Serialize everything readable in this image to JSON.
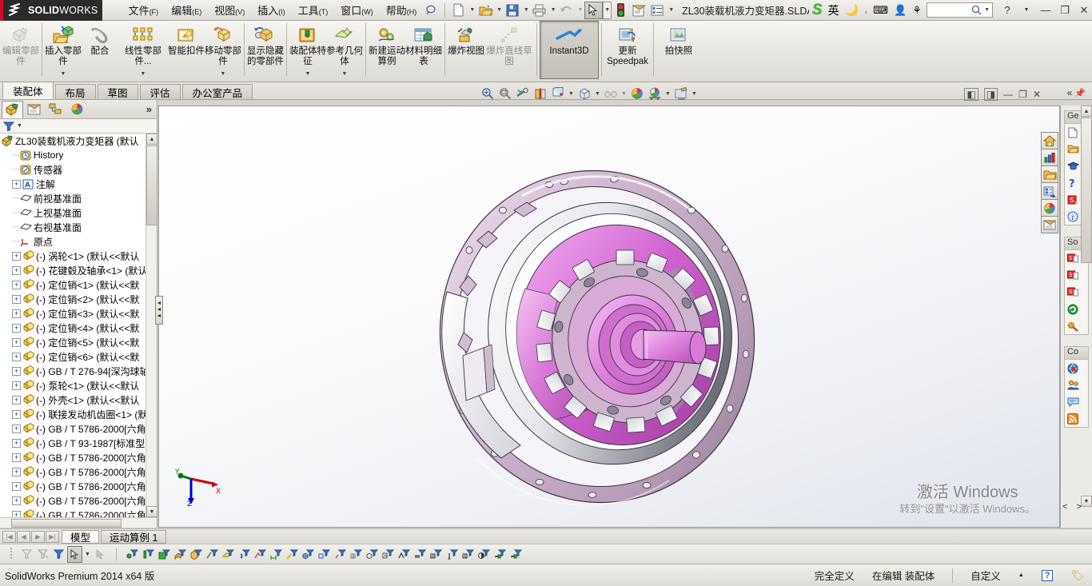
{
  "titlebar": {
    "brand_ds": "2S",
    "brand_name": "SOLID",
    "brand_name2": "WORKS",
    "menus": [
      {
        "label": "文件",
        "key": "(F)"
      },
      {
        "label": "编辑",
        "key": "(E)"
      },
      {
        "label": "视图",
        "key": "(V)"
      },
      {
        "label": "插入",
        "key": "(I)"
      },
      {
        "label": "工具",
        "key": "(T)"
      },
      {
        "label": "窗口",
        "key": "(W)"
      },
      {
        "label": "帮助",
        "key": "(H)"
      }
    ],
    "document_title": "ZL30装载机液力变矩器.SLDA",
    "ime_lang": "英",
    "search_placeholder": ""
  },
  "ribbon": {
    "buttons": [
      {
        "name": "edit-component",
        "label": "编辑零部件",
        "icon": "edit-component-icon",
        "disabled": true,
        "caret": false,
        "pressed": false
      },
      {
        "name": "insert-components",
        "label": "插入零部件",
        "icon": "insert-component-icon",
        "disabled": false,
        "caret": true,
        "pressed": false
      },
      {
        "name": "mate",
        "label": "配合",
        "icon": "mate-icon",
        "disabled": false,
        "caret": false,
        "pressed": false
      },
      {
        "name": "linear-component-pattern",
        "label": "线性零部件...",
        "icon": "linear-pattern-icon",
        "disabled": false,
        "caret": true,
        "pressed": false
      },
      {
        "name": "smart-fasteners",
        "label": "智能扣件",
        "icon": "smart-fastener-icon",
        "disabled": false,
        "caret": false,
        "pressed": false
      },
      {
        "name": "move-component",
        "label": "移动零部件",
        "icon": "move-component-icon",
        "disabled": false,
        "caret": true,
        "pressed": false
      },
      {
        "name": "show-hidden-components",
        "label": "显示隐藏的零部件",
        "icon": "show-hidden-icon",
        "disabled": false,
        "caret": false,
        "pressed": false
      },
      {
        "name": "assembly-features",
        "label": "装配体特征",
        "icon": "assembly-feature-icon",
        "disabled": false,
        "caret": true,
        "pressed": false
      },
      {
        "name": "reference-geometry",
        "label": "参考几何体",
        "icon": "reference-geometry-icon",
        "disabled": false,
        "caret": true,
        "pressed": false
      },
      {
        "name": "new-motion-study",
        "label": "新建运动算例",
        "icon": "motion-study-icon",
        "disabled": false,
        "caret": false,
        "pressed": false
      },
      {
        "name": "bill-of-materials",
        "label": "材料明细表",
        "icon": "bom-icon",
        "disabled": false,
        "caret": false,
        "pressed": false
      },
      {
        "name": "exploded-view",
        "label": "爆炸视图",
        "icon": "exploded-view-icon",
        "disabled": false,
        "caret": false,
        "pressed": false
      },
      {
        "name": "explode-line-sketch",
        "label": "爆炸直线草图",
        "icon": "explode-line-icon",
        "disabled": true,
        "caret": false,
        "pressed": false
      },
      {
        "name": "instant3d",
        "label": "Instant3D",
        "icon": "instant3d-icon",
        "disabled": false,
        "caret": false,
        "pressed": true
      },
      {
        "name": "update-speedpak",
        "label": "更新Speedpak",
        "icon": "speedpak-icon",
        "disabled": false,
        "caret": false,
        "pressed": false
      },
      {
        "name": "take-snapshot",
        "label": "拍快照",
        "icon": "snapshot-icon",
        "disabled": false,
        "caret": false,
        "pressed": false
      }
    ],
    "separators_after": [
      0,
      6,
      9,
      12,
      13
    ]
  },
  "command_tabs": [
    {
      "label": "装配体",
      "active": true
    },
    {
      "label": "布局",
      "active": false
    },
    {
      "label": "草图",
      "active": false
    },
    {
      "label": "评估",
      "active": false
    },
    {
      "label": "办公室产品",
      "active": false
    }
  ],
  "viewport_toolbar": [
    {
      "name": "zoom-to-fit-icon",
      "caret": false
    },
    {
      "name": "zoom-to-area-icon",
      "caret": false
    },
    {
      "name": "previous-view-icon",
      "caret": false
    },
    {
      "name": "section-view-icon",
      "caret": false
    },
    {
      "name": "view-orientation-icon",
      "caret": true
    },
    {
      "name": "display-style-icon",
      "caret": true
    },
    {
      "name": "hide-show-items-icon",
      "caret": true
    },
    {
      "name": "edit-appearance-icon",
      "caret": false
    },
    {
      "name": "apply-scene-icon",
      "caret": true
    },
    {
      "name": "view-settings-icon",
      "caret": true
    }
  ],
  "window_buttons": [
    "restore-left-icon",
    "restore-right-icon",
    "minimize-icon",
    "maximize-icon",
    "close-icon"
  ],
  "left_panel": {
    "tabs": [
      {
        "name": "feature-manager-tab",
        "icon": "feature-tree-icon",
        "active": true
      },
      {
        "name": "property-manager-tab",
        "icon": "property-manager-icon",
        "active": false
      },
      {
        "name": "configuration-manager-tab",
        "icon": "configuration-icon",
        "active": false
      },
      {
        "name": "display-manager-tab",
        "icon": "display-manager-icon",
        "active": false
      }
    ],
    "more_label": "»",
    "filter_icon": "filter-icon",
    "tree": [
      {
        "label": "ZL30装载机液力变矩器  (默认",
        "icon": "assembly-icon",
        "expand": "none",
        "indent": 0,
        "root": true
      },
      {
        "label": "History",
        "icon": "history-icon",
        "expand": "none",
        "indent": 1
      },
      {
        "label": "传感器",
        "icon": "sensor-icon",
        "expand": "none",
        "indent": 1
      },
      {
        "label": "注解",
        "icon": "annotation-icon",
        "expand": "plus",
        "indent": 1
      },
      {
        "label": "前视基准面",
        "icon": "plane-icon",
        "expand": "none",
        "indent": 1
      },
      {
        "label": "上视基准面",
        "icon": "plane-icon",
        "expand": "none",
        "indent": 1
      },
      {
        "label": "右视基准面",
        "icon": "plane-icon",
        "expand": "none",
        "indent": 1
      },
      {
        "label": "原点",
        "icon": "origin-icon",
        "expand": "none",
        "indent": 1
      },
      {
        "label": "(-) 涡轮<1>  (默认<<默认",
        "icon": "part-icon",
        "expand": "plus",
        "indent": 1
      },
      {
        "label": "(-) 花键毂及轴承<1>  (默认",
        "icon": "part-icon",
        "expand": "plus",
        "indent": 1
      },
      {
        "label": "(-) 定位销<1>  (默认<<默",
        "icon": "part-icon",
        "expand": "plus",
        "indent": 1
      },
      {
        "label": "(-) 定位销<2>  (默认<<默",
        "icon": "part-icon",
        "expand": "plus",
        "indent": 1
      },
      {
        "label": "(-) 定位销<3>  (默认<<默",
        "icon": "part-icon",
        "expand": "plus",
        "indent": 1
      },
      {
        "label": "(-) 定位销<4>  (默认<<默",
        "icon": "part-icon",
        "expand": "plus",
        "indent": 1
      },
      {
        "label": "(-) 定位销<5>  (默认<<默",
        "icon": "part-icon",
        "expand": "plus",
        "indent": 1
      },
      {
        "label": "(-) 定位销<6>  (默认<<默",
        "icon": "part-icon",
        "expand": "plus",
        "indent": 1
      },
      {
        "label": "(-) GB / T 276-94[深沟球轴",
        "icon": "part-icon",
        "expand": "plus",
        "indent": 1
      },
      {
        "label": "(-) 泵轮<1>  (默认<<默认",
        "icon": "part-icon",
        "expand": "plus",
        "indent": 1
      },
      {
        "label": "(-) 外壳<1>  (默认<<默认",
        "icon": "part-icon",
        "expand": "plus",
        "indent": 1
      },
      {
        "label": "(-) 联接发动机齿圈<1>  (默",
        "icon": "part-icon",
        "expand": "plus",
        "indent": 1
      },
      {
        "label": "(-) GB / T 5786-2000[六角",
        "icon": "part-icon",
        "expand": "plus",
        "indent": 1
      },
      {
        "label": "(-) GB / T 93-1987[标准型",
        "icon": "part-icon",
        "expand": "plus",
        "indent": 1
      },
      {
        "label": "(-) GB / T 5786-2000[六角",
        "icon": "part-icon",
        "expand": "plus",
        "indent": 1
      },
      {
        "label": "(-) GB / T 5786-2000[六角",
        "icon": "part-icon",
        "expand": "plus",
        "indent": 1
      },
      {
        "label": "(-) GB / T 5786-2000[六角",
        "icon": "part-icon",
        "expand": "plus",
        "indent": 1
      },
      {
        "label": "(-) GB / T 5786-2000[六角",
        "icon": "part-icon",
        "expand": "plus",
        "indent": 1
      },
      {
        "label": "(-) GB / T 5786-2000[六角",
        "icon": "part-icon",
        "expand": "plus",
        "indent": 1
      }
    ]
  },
  "right_toolbar": [
    {
      "name": "view-home-icon"
    },
    {
      "name": "report-icon"
    },
    {
      "name": "open-folder-icon"
    },
    {
      "name": "design-library-icon"
    },
    {
      "name": "appearances-icon"
    },
    {
      "name": "custom-properties-icon"
    }
  ],
  "task_pane": {
    "groups": [
      {
        "title": "Ge",
        "items": [
          "new-document-icon",
          "open-folder-icon",
          "learning-icon",
          "help-icon",
          "whats-new-icon",
          "info-icon"
        ]
      },
      {
        "title": "So",
        "items": [
          "sw-resource-1-icon",
          "sw-resource-2-icon",
          "sw-resource-3-icon",
          "sw-refresh-icon",
          "sw-tools-icon"
        ]
      },
      {
        "title": "Co",
        "items": [
          "community-icon",
          "user-group-icon",
          "forum-icon",
          "rss-icon"
        ]
      }
    ],
    "nav": "< >"
  },
  "graphics": {
    "triad_axes": [
      {
        "label": "X",
        "color": "#cc0000"
      },
      {
        "label": "Y",
        "color": "#007700"
      },
      {
        "label": "Z",
        "color": "#0000cc"
      }
    ],
    "watermark_line1": "激活 Windows",
    "watermark_line2": "转到\"设置\"以激活 Windows。",
    "model_colors": {
      "primary": "#d18fd0",
      "secondary": "#c9aec9",
      "highlight": "#f0c6ef",
      "white": "#f4f4f6",
      "shadow": "#8a7f8a",
      "outline": "#3a3340"
    }
  },
  "bottom": {
    "nav_buttons": [
      "first-icon",
      "prev-icon",
      "next-icon",
      "last-icon"
    ],
    "model_tabs": [
      {
        "label": "模型",
        "active": true
      },
      {
        "label": "运动算例 1",
        "active": false
      }
    ]
  },
  "statusbar": {
    "product": "SolidWorks Premium 2014 x64 版",
    "state": "完全定义",
    "editing": "在编辑 装配体",
    "custom": "自定义",
    "help_icon": "help-badge-icon",
    "tag_icon": "tag-icon"
  }
}
